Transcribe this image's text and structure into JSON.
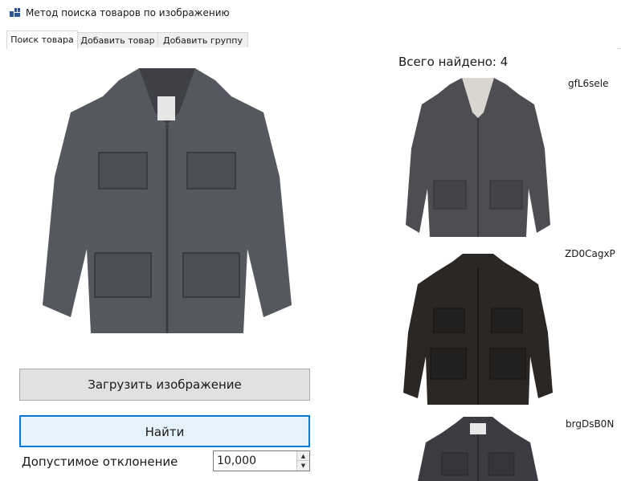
{
  "window": {
    "title": "Метод поиска товаров по изображению",
    "icon": "app-icon"
  },
  "tabs": [
    {
      "label": "Поиск товара",
      "active": true
    },
    {
      "label": "Добавить товар",
      "active": false
    },
    {
      "label": "Добавить группу",
      "active": false
    }
  ],
  "search": {
    "load_button": "Загрузить изображение",
    "find_button": "Найти",
    "tolerance_label": "Допустимое отклонение",
    "tolerance_value": "10,000"
  },
  "results": {
    "total_text": "Всего найдено: 4",
    "items": [
      {
        "id": "gfL6sele",
        "color": "#4d4d52"
      },
      {
        "id": "ZD0CagxP",
        "color": "#2a2724"
      },
      {
        "id": "brgDsB0N",
        "color": "#3b3d42"
      }
    ]
  },
  "colors": {
    "accent": "#0078d7",
    "button_bg": "#e1e1e1",
    "query_jacket": "#55585f"
  }
}
